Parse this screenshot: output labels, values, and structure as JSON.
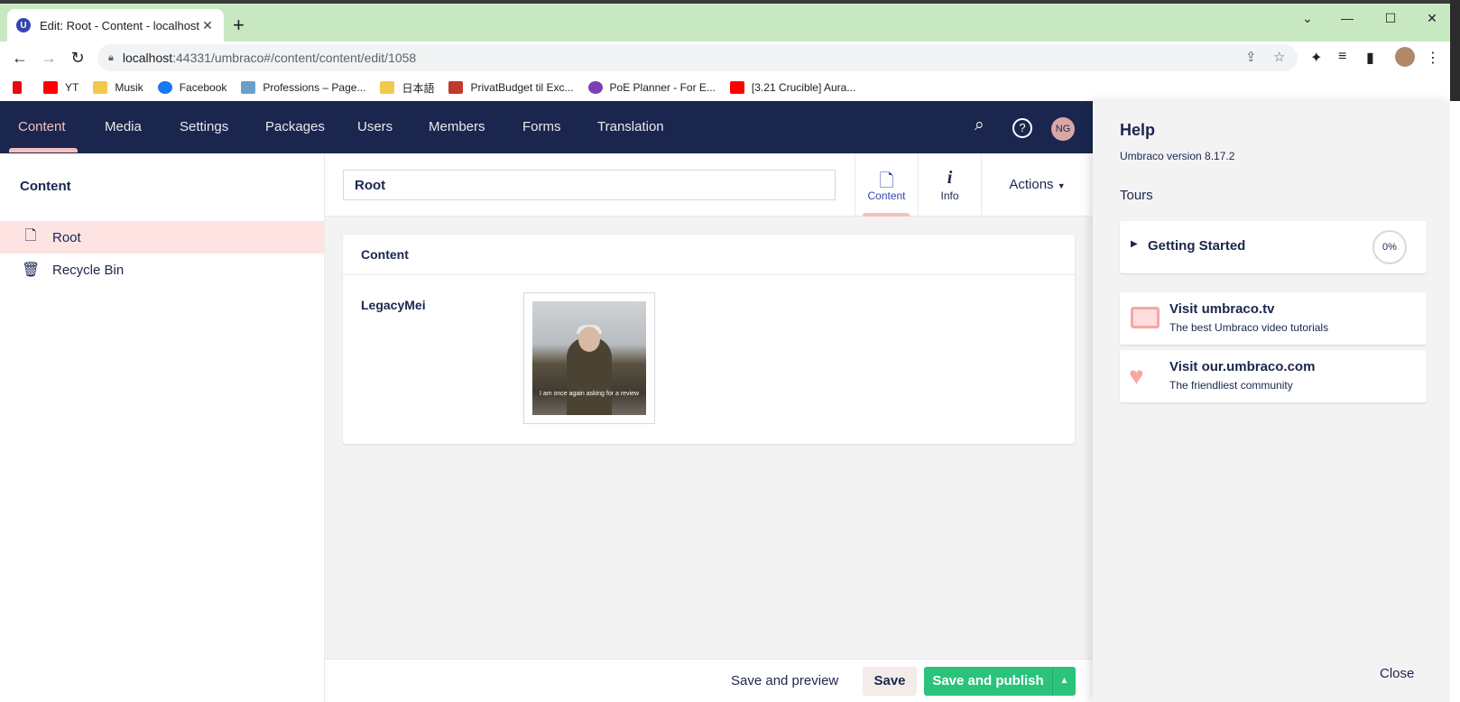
{
  "browser": {
    "tab_title": "Edit: Root - Content - localhost",
    "tab_favicon": "U",
    "url_host": "localhost",
    "url_path": ":44331/umbraco#/content/content/edit/1058",
    "bookmarks": [
      {
        "label": "",
        "color": "#e50914"
      },
      {
        "label": "YT",
        "color": "#ff0000"
      },
      {
        "label": "Musik",
        "color": "#f2c94c"
      },
      {
        "label": "Facebook",
        "color": "#1877f2"
      },
      {
        "label": "Professions – Page...",
        "color": "#6aa0c8"
      },
      {
        "label": "日本語",
        "color": "#f2c94c"
      },
      {
        "label": "PrivatBudget til Exc...",
        "color": "#c0392b"
      },
      {
        "label": "PoE Planner - For E...",
        "color": "#7b3fb5"
      },
      {
        "label": "[3.21 Crucible] Aura...",
        "color": "#ff0000"
      }
    ]
  },
  "header": {
    "sections": [
      "Content",
      "Media",
      "Settings",
      "Packages",
      "Users",
      "Members",
      "Forms",
      "Translation"
    ],
    "avatar_initials": "NG"
  },
  "tree": {
    "title": "Content",
    "items": [
      {
        "label": "Root",
        "icon": "document-icon"
      },
      {
        "label": "Recycle Bin",
        "icon": "trash-icon"
      }
    ]
  },
  "editor": {
    "name_value": "Root",
    "apps": [
      {
        "label": "Content",
        "icon": "document-icon"
      },
      {
        "label": "Info",
        "icon": "info-icon"
      }
    ],
    "actions_label": "Actions",
    "group_title": "Content",
    "property_label": "LegacyMei",
    "media_caption": "I am once again asking for a review"
  },
  "footer": {
    "preview_label": "Save and preview",
    "save_label": "Save",
    "publish_label": "Save and publish"
  },
  "help": {
    "title": "Help",
    "version": "Umbraco version 8.17.2",
    "tours_title": "Tours",
    "tour_name": "Getting Started",
    "tour_progress": "0%",
    "links": [
      {
        "title": "Visit umbraco.tv",
        "subtitle": "The best Umbraco video tutorials",
        "icon": "tv-icon"
      },
      {
        "title": "Visit our.umbraco.com",
        "subtitle": "The friendliest community",
        "icon": "heart-icon"
      }
    ],
    "close_label": "Close"
  },
  "colors": {
    "header_bg": "#1b264f",
    "accent_pink": "#f5c1bc",
    "publish_green": "#2bc37c",
    "tab_strip": "#c8e8c2"
  }
}
